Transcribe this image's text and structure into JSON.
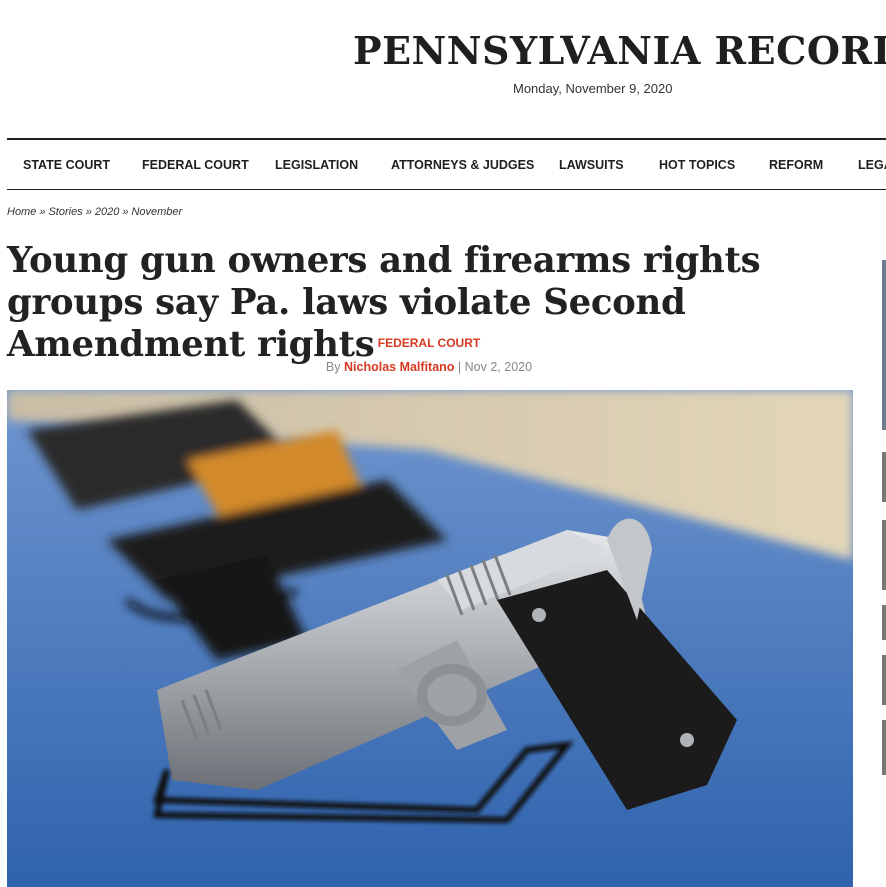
{
  "site": {
    "title": "PENNSYLVANIA RECORD",
    "date": "Monday, November 9, 2020"
  },
  "nav": {
    "items": [
      {
        "label": "STATE COURT"
      },
      {
        "label": "FEDERAL COURT"
      },
      {
        "label": "LEGISLATION"
      },
      {
        "label": "ATTORNEYS & JUDGES"
      },
      {
        "label": "LAWSUITS"
      },
      {
        "label": "HOT TOPICS"
      },
      {
        "label": "REFORM"
      },
      {
        "label": "LEGA"
      }
    ]
  },
  "breadcrumb": {
    "items": [
      "Home",
      "Stories",
      "2020",
      "November"
    ],
    "separator": "»"
  },
  "article": {
    "headline": "Young gun owners and firearms rights groups say Pa. laws violate Second Amendment rights",
    "category": "FEDERAL COURT",
    "byline_prefix": "By",
    "author": "Nicholas Malfitano",
    "divider": "|",
    "date": "Nov 2, 2020"
  },
  "colors": {
    "accent": "#d63a22",
    "table_blue": "#3a6fb8"
  },
  "icons": {
    "hero_image": "handgun-on-display-stand-photo"
  }
}
